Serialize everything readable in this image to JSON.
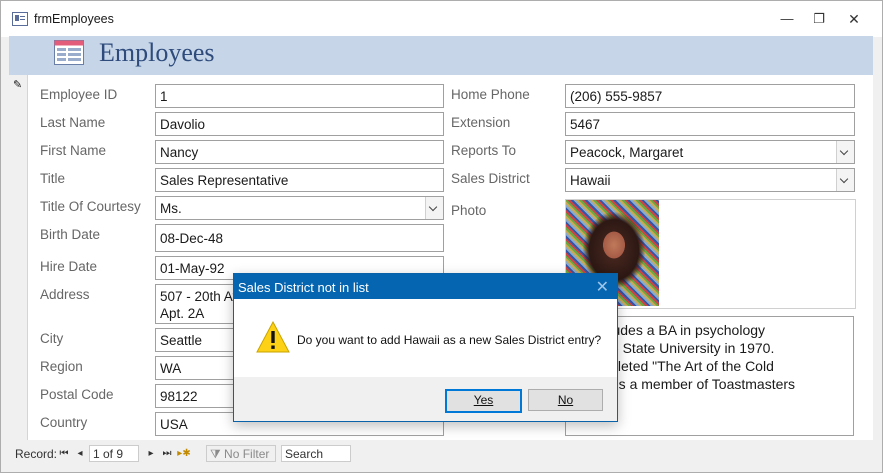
{
  "window": {
    "title": "frmEmployees"
  },
  "header": {
    "title": "Employees"
  },
  "fields_left": [
    {
      "label": "Employee ID",
      "value": "1"
    },
    {
      "label": "Last Name",
      "value": "Davolio"
    },
    {
      "label": "First Name",
      "value": "Nancy"
    },
    {
      "label": "Title",
      "value": "Sales Representative"
    },
    {
      "label": "Title Of Courtesy",
      "value": "Ms."
    },
    {
      "label": "Birth Date",
      "value": "08-Dec-48"
    },
    {
      "label": "Hire Date",
      "value": "01-May-92"
    },
    {
      "label": "Address",
      "value": "507 - 20th Av",
      "value2": "Apt. 2A"
    },
    {
      "label": "City",
      "value": "Seattle"
    },
    {
      "label": "Region",
      "value": "WA"
    },
    {
      "label": "Postal Code",
      "value": "98122"
    },
    {
      "label": "Country",
      "value": "USA"
    }
  ],
  "fields_right": [
    {
      "label": "Home Phone",
      "value": "(206) 555-9857"
    },
    {
      "label": "Extension",
      "value": "5467"
    },
    {
      "label": "Reports To",
      "value": "Peacock, Margaret"
    },
    {
      "label": "Sales District",
      "value": "Hawaii"
    },
    {
      "label": "Photo"
    }
  ],
  "notes": {
    "lines": [
      "on includes a BA in psychology",
      "olorado State University in 1970.",
      "o completed \"The Art of the Cold",
      "Nancy is a member of Toastmasters",
      "tional."
    ]
  },
  "navigation": {
    "record_label": "Record:",
    "record_value": "1 of 9",
    "no_filter": "No Filter",
    "search": "Search"
  },
  "dialog": {
    "title": "Sales District not in list",
    "message": "Do you want to add Hawaii as a new Sales District entry?",
    "yes": "Yes",
    "no": "No",
    "close": "✕"
  }
}
